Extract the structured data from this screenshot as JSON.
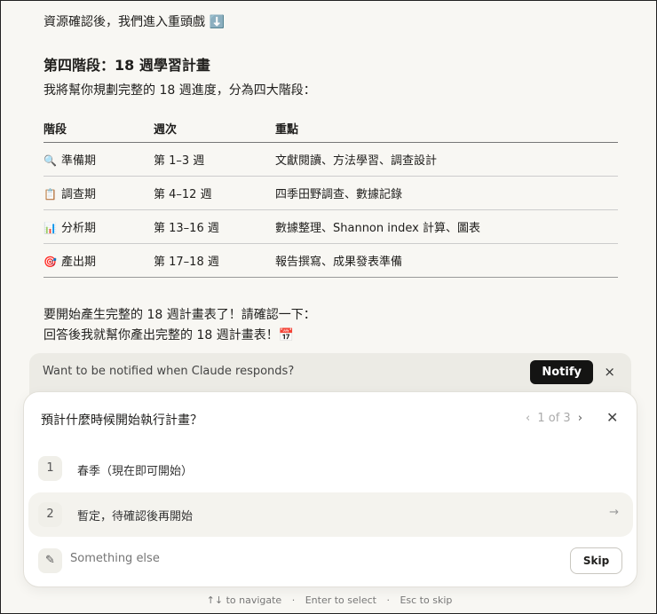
{
  "intro": "資源確認後，我們進入重頭戲",
  "intro_emoji": "⬇️",
  "heading": "第四階段：18 週學習計畫",
  "subtitle": "我將幫你規劃完整的 18 週進度，分為四大階段：",
  "table": {
    "headers": [
      "階段",
      "週次",
      "重點"
    ],
    "rows": [
      {
        "icon": "🔍",
        "stage": "準備期",
        "weeks": "第 1–3 週",
        "focus": "文獻閱讀、方法學習、調查設計"
      },
      {
        "icon": "📋",
        "stage": "調查期",
        "weeks": "第 4–12 週",
        "focus": "四季田野調查、數據記錄"
      },
      {
        "icon": "📊",
        "stage": "分析期",
        "weeks": "第 13–16 週",
        "focus": "數據整理、Shannon index 計算、圖表"
      },
      {
        "icon": "🎯",
        "stage": "產出期",
        "weeks": "第 17–18 週",
        "focus": "報告撰寫、成果發表準備"
      }
    ]
  },
  "outro1": "要開始產生完整的 18 週計畫表了！請確認一下：",
  "outro2": "回答後我就幫你產出完整的 18 週計畫表！",
  "outro_emoji": "📅",
  "notify": {
    "text": "Want to be notified when Claude responds?",
    "button": "Notify",
    "close": "×"
  },
  "question": {
    "title": "預計什麼時候開始執行計畫？",
    "pager": "1 of 3",
    "prev": "‹",
    "next": "›",
    "close": "✕",
    "options": [
      {
        "num": "1",
        "label": "春季（現在即可開始）"
      },
      {
        "num": "2",
        "label": "暫定，待確認後再開始"
      }
    ],
    "other_placeholder": "Something else",
    "skip": "Skip",
    "arrow": "→"
  },
  "footer": {
    "navigate": "↑↓ to navigate",
    "select": "Enter to select",
    "esc": "Esc to skip",
    "sep": "·"
  }
}
